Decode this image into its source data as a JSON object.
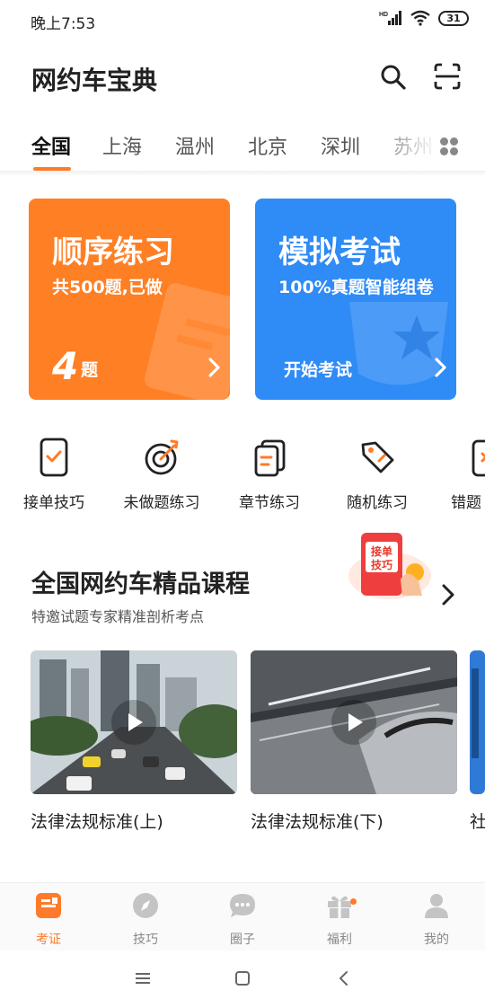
{
  "status_bar": {
    "time": "晚上7:53",
    "network": "HD",
    "battery": "31"
  },
  "header": {
    "title": "网约车宝典",
    "search_icon": "search-icon",
    "scan_icon": "scan-icon"
  },
  "city_tabs": {
    "items": [
      "全国",
      "上海",
      "温州",
      "北京",
      "深圳",
      "苏州"
    ],
    "active": "全国",
    "more_icon": "grid-icon"
  },
  "cards": {
    "sequential": {
      "title": "顺序练习",
      "subtitle": "共500题,已做",
      "count": "4",
      "unit": "题",
      "color": "#ff7f24"
    },
    "mock": {
      "title": "模拟考试",
      "subtitle": "100%真题智能组卷",
      "action": "开始考试",
      "color": "#2f8bf5"
    }
  },
  "quick_actions": [
    {
      "label": "接单技巧",
      "icon": "phone-check-icon"
    },
    {
      "label": "未做题练习",
      "icon": "target-icon"
    },
    {
      "label": "章节练习",
      "icon": "chapter-icon"
    },
    {
      "label": "随机练习",
      "icon": "tag-icon"
    },
    {
      "label": "错题",
      "icon": "wrong-book-icon"
    }
  ],
  "course_section": {
    "title": "全国网约车精品课程",
    "subtitle": "特邀试题专家精准剖析考点",
    "promo_text_1": "接单",
    "promo_text_2": "技巧"
  },
  "videos": [
    {
      "title": "法律法规标准(上)"
    },
    {
      "title": "法律法规标准(下)"
    },
    {
      "title": "社"
    }
  ],
  "bottom_nav": [
    {
      "label": "考证",
      "icon": "exam-icon",
      "active": true
    },
    {
      "label": "技巧",
      "icon": "compass-icon"
    },
    {
      "label": "圈子",
      "icon": "chat-icon"
    },
    {
      "label": "福利",
      "icon": "gift-icon",
      "badge": true
    },
    {
      "label": "我的",
      "icon": "user-icon"
    }
  ],
  "colors": {
    "accent": "#ff7a2a",
    "orange_card": "#ff7f24",
    "blue_card": "#2f8bf5"
  }
}
